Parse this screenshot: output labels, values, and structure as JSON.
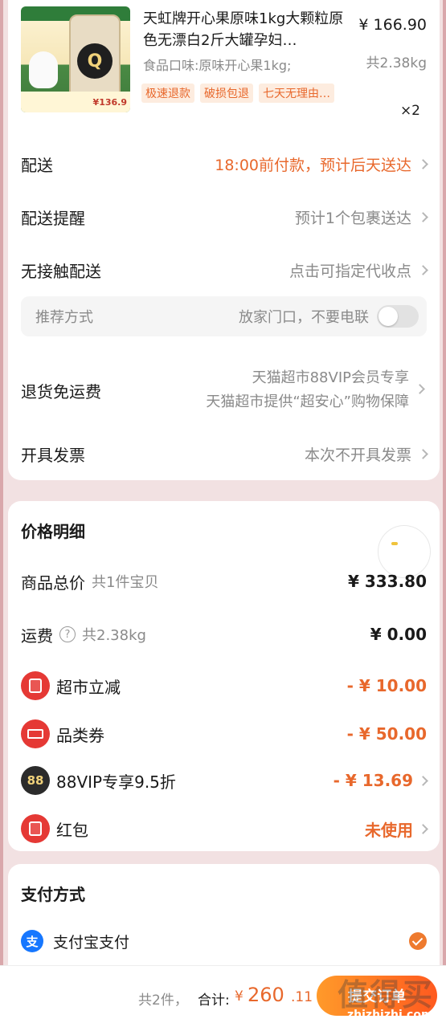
{
  "product": {
    "title": "天虹牌开心果原味1kg大颗粒原色无漂白2斤大罐孕妇…",
    "price": "¥ 166.90",
    "sku": "食品口味:原味开心果1kg;",
    "weight": "共2.38kg",
    "tags": [
      "极速退款",
      "破损包退",
      "七天无理由…"
    ],
    "quantity": "×2",
    "thumb_price": "¥136.9",
    "thumb_jar_letter": "Q"
  },
  "order_rows": {
    "delivery": {
      "label": "配送",
      "value": "18:00前付款，预计后天送达"
    },
    "delivery_reminder": {
      "label": "配送提醒",
      "value": "预计1个包裹送达"
    },
    "contactless": {
      "label": "无接触配送",
      "value": "点击可指定代收点"
    },
    "recommend": {
      "label": "推荐方式",
      "value": "放家门口，不要电联"
    },
    "return_free": {
      "label": "退货免运费",
      "value1": "天猫超市88VIP会员专享",
      "value2": "天猫超市提供“超安心”购物保障"
    },
    "invoice": {
      "label": "开具发票",
      "value": "本次不开具发票"
    }
  },
  "price_detail": {
    "title": "价格明细",
    "goods_total": {
      "label": "商品总价",
      "sub": "共1件宝贝",
      "amount": "¥ 333.80"
    },
    "shipping": {
      "label": "运费",
      "sub": "共2.38kg",
      "amount": "¥ 0.00"
    },
    "supermarket_off": {
      "label": "超市立减",
      "amount": "- ¥ 10.00"
    },
    "category_coupon": {
      "label": "品类券",
      "amount": "- ¥ 50.00"
    },
    "vip": {
      "label": "88VIP专享9.5折",
      "amount": "- ¥ 13.69",
      "badge": "88"
    },
    "red_packet": {
      "label": "红包",
      "amount": "未使用"
    }
  },
  "payment": {
    "title": "支付方式",
    "method": "支付宝支付",
    "alipay_glyph": "支"
  },
  "bottom_bar": {
    "count": "共2件，",
    "total_label": "合计:",
    "currency": "¥",
    "total_int": "260",
    "total_dec": ".11",
    "submit": "提交订单"
  },
  "watermark": {
    "logo": "值得买",
    "url": "zhizhizhi.com"
  },
  "colors": {
    "accent": "#e8682c",
    "page_bg": "#f2e1e2",
    "alipay": "#1677ff"
  }
}
